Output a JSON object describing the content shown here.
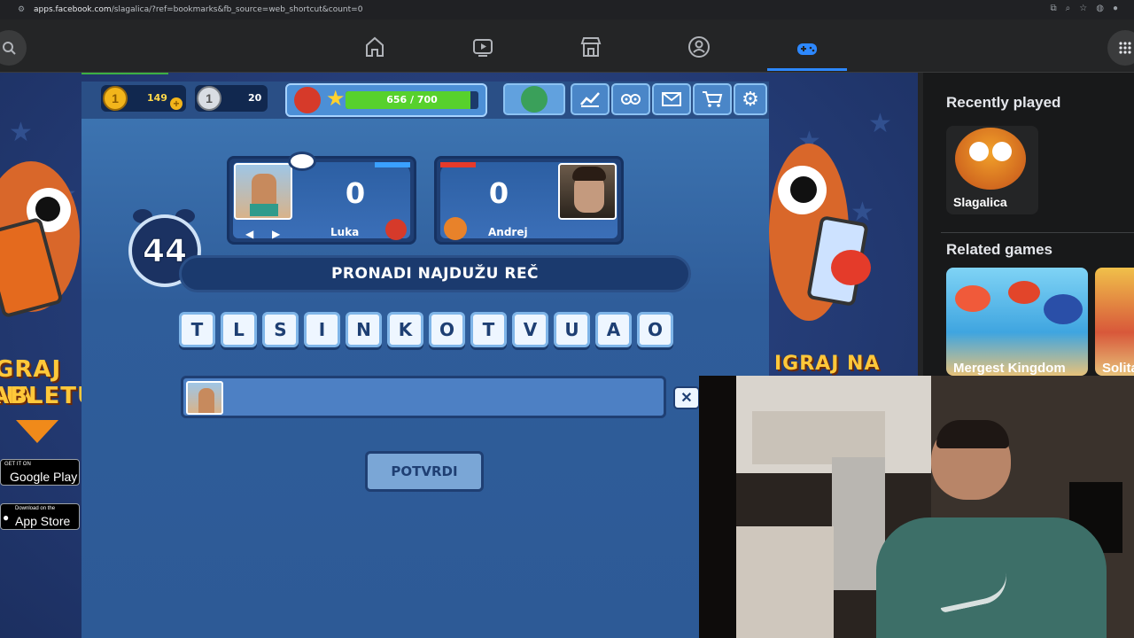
{
  "browser": {
    "url_host": "apps.facebook.com",
    "url_path": "/slagalica/?ref=bookmarks&fb_source=web_shortcut&count=0"
  },
  "fb_nav": {
    "items": [
      {
        "icon": "home-icon"
      },
      {
        "icon": "video-icon"
      },
      {
        "icon": "marketplace-icon"
      },
      {
        "icon": "groups-icon"
      },
      {
        "icon": "gaming-icon",
        "active": true
      }
    ]
  },
  "hud": {
    "gold_coins": "149",
    "silver_coins": "20",
    "xp_text": "656 / 700",
    "xp_progress": 0.937
  },
  "players": [
    {
      "name": "Luka",
      "score": "0"
    },
    {
      "name": "Andrej",
      "score": "0"
    }
  ],
  "game": {
    "timer": "44",
    "task": "PRONADI NAJDUŽU REČ",
    "letters": [
      "T",
      "L",
      "S",
      "I",
      "N",
      "K",
      "O",
      "T",
      "V",
      "U",
      "A",
      "O"
    ],
    "answer": "",
    "confirm_label": "POTVRDI"
  },
  "promo": {
    "left_text_1": "GRAJ NA",
    "left_text_2": "ABLETU",
    "right_text": "IGRAJ NA",
    "google_play_small": "GET IT ON",
    "google_play_big": "Google Play",
    "app_store_small": "Download on the",
    "app_store_big": "App Store"
  },
  "sidebar": {
    "recently_played_title": "Recently played",
    "recent_games": [
      {
        "name": "Slagalica"
      }
    ],
    "related_title": "Related games",
    "related_games": [
      {
        "name": "Mergest Kingdom"
      },
      {
        "name": "Solita"
      }
    ]
  },
  "colors": {
    "fb_accent": "#2d88ff",
    "xp_fill": "#57d12c",
    "panel_blue": "#3f78b5"
  }
}
